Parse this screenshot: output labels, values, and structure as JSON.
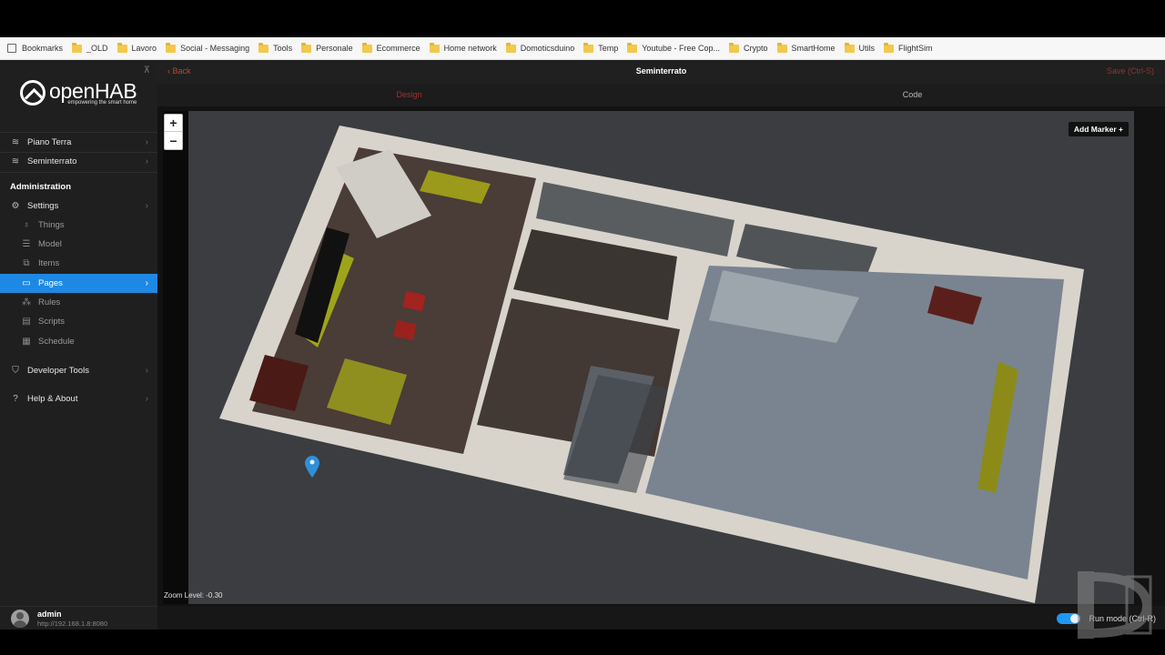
{
  "bookmarks_bar": {
    "items": [
      {
        "label": "Bookmarks",
        "icon": "bookmarks-icon"
      },
      {
        "label": "_OLD",
        "icon": "folder-icon"
      },
      {
        "label": "Lavoro",
        "icon": "folder-icon"
      },
      {
        "label": "Social - Messaging",
        "icon": "folder-icon"
      },
      {
        "label": "Tools",
        "icon": "folder-icon"
      },
      {
        "label": "Personale",
        "icon": "folder-icon"
      },
      {
        "label": "Ecommerce",
        "icon": "folder-icon"
      },
      {
        "label": "Home network",
        "icon": "folder-icon"
      },
      {
        "label": "Domoticsduino",
        "icon": "folder-icon"
      },
      {
        "label": "Temp",
        "icon": "folder-icon"
      },
      {
        "label": "Youtube - Free Cop...",
        "icon": "folder-icon"
      },
      {
        "label": "Crypto",
        "icon": "folder-icon"
      },
      {
        "label": "SmartHome",
        "icon": "folder-icon"
      },
      {
        "label": "Utils",
        "icon": "folder-icon"
      },
      {
        "label": "FlightSim",
        "icon": "folder-icon"
      }
    ]
  },
  "sidebar": {
    "logo_title": "openHAB",
    "logo_subtitle": "empowering the smart home",
    "pages": [
      {
        "label": "Piano Terra",
        "icon": "layers-icon"
      },
      {
        "label": "Seminterrato",
        "icon": "layers-icon"
      }
    ],
    "section_title": "Administration",
    "settings": {
      "label": "Settings",
      "icon": "gear-icon"
    },
    "settings_items": [
      {
        "label": "Things",
        "icon": "lightbulb-icon"
      },
      {
        "label": "Model",
        "icon": "list-icon"
      },
      {
        "label": "Items",
        "icon": "squares-icon"
      },
      {
        "label": "Pages",
        "icon": "monitor-icon",
        "active": true
      },
      {
        "label": "Rules",
        "icon": "wand-icon"
      },
      {
        "label": "Scripts",
        "icon": "document-icon"
      },
      {
        "label": "Schedule",
        "icon": "calendar-icon"
      }
    ],
    "developer_tools": {
      "label": "Developer Tools",
      "icon": "shield-icon"
    },
    "help": {
      "label": "Help & About",
      "icon": "help-icon"
    },
    "user": {
      "name": "admin",
      "url": "http://192.168.1.8:8080"
    }
  },
  "header": {
    "back_label": "Back",
    "title": "Seminterrato",
    "save_label": "Save (Ctrl-S)"
  },
  "tabs": [
    {
      "label": "Design",
      "active": true
    },
    {
      "label": "Code",
      "active": false
    }
  ],
  "map": {
    "zoom_in": "+",
    "zoom_out": "−",
    "add_marker_label": "Add Marker +",
    "zoom_level_text": "Zoom Level: -0.30",
    "marker_color": "#2f8fd8"
  },
  "footer": {
    "run_mode_label": "Run mode (Ctrl-R)",
    "run_mode_on": true
  },
  "colors": {
    "accent_blue": "#1e88e5",
    "accent_red": "#a3312a",
    "sidebar_bg": "#1f1f1f"
  }
}
